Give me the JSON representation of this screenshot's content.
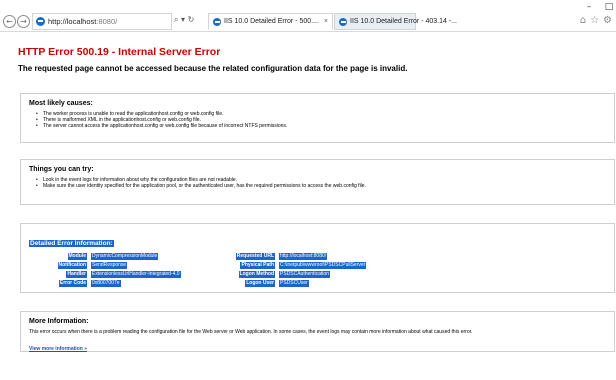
{
  "browser": {
    "address_host": "http://localhost",
    "address_port": ":8080/",
    "address_tools": "⌕ ▾ ↻",
    "tabs": [
      {
        "title": "IIS 10.0 Detailed Error - 500....",
        "close": "×"
      },
      {
        "title": "IIS 10.0 Detailed Error - 403.14 -..."
      }
    ],
    "window_controls": [
      "–",
      "□"
    ],
    "right_icons": [
      "⌂",
      "☆",
      "⚙"
    ]
  },
  "page": {
    "title": "HTTP Error 500.19 - Internal Server Error",
    "subtitle": "The requested page cannot be accessed because the related configuration data for the page is invalid."
  },
  "causes": {
    "heading": "Most likely causes:",
    "items": [
      "The worker process is unable to read the applicationhost.config or web.config file.",
      "There is malformed XML in the applicationhost.config or web.config file.",
      "The server cannot access the applicationhost.config or web.config file because of incorrect NTFS permissions."
    ]
  },
  "try": {
    "heading": "Things you can try:",
    "items": [
      "Look in the event logs for information about why the configuration files are not readable.",
      "Make sure the user identity specified for the application pool, or the authenticated user, has the required permissions to access the web.config file."
    ]
  },
  "details": {
    "heading": "Detailed Error Information:",
    "rows": [
      {
        "label": "Module",
        "value": "DynamicCompressionModule",
        "label2": "Requested URL",
        "value2": "http://localhost:8080/"
      },
      {
        "label": "Notification",
        "value": "SendResponse",
        "label2": "Physical Path",
        "value2": "C:\\inetpub\\wwwroot\\PSDSCPullServer"
      },
      {
        "label": "Handler",
        "value": "ExtensionlessUrlHandler-Integrated-4.0",
        "label2": "Logon Method",
        "value2": "PSDSCAuthentication"
      },
      {
        "label": "Error Code",
        "value": "0x8007007e",
        "label2": "Logon User",
        "value2": "PSDSCUser"
      }
    ]
  },
  "more": {
    "heading": "More Information:",
    "text": "This error occurs when there is a problem reading the configuration file for the Web server or Web application. In some cases, the event logs may contain more information about what caused this error.",
    "link": "View more information »"
  },
  "colors": {
    "error_title": "#cc0000",
    "highlight": "#1a66cc",
    "link": "#1a55bb"
  }
}
